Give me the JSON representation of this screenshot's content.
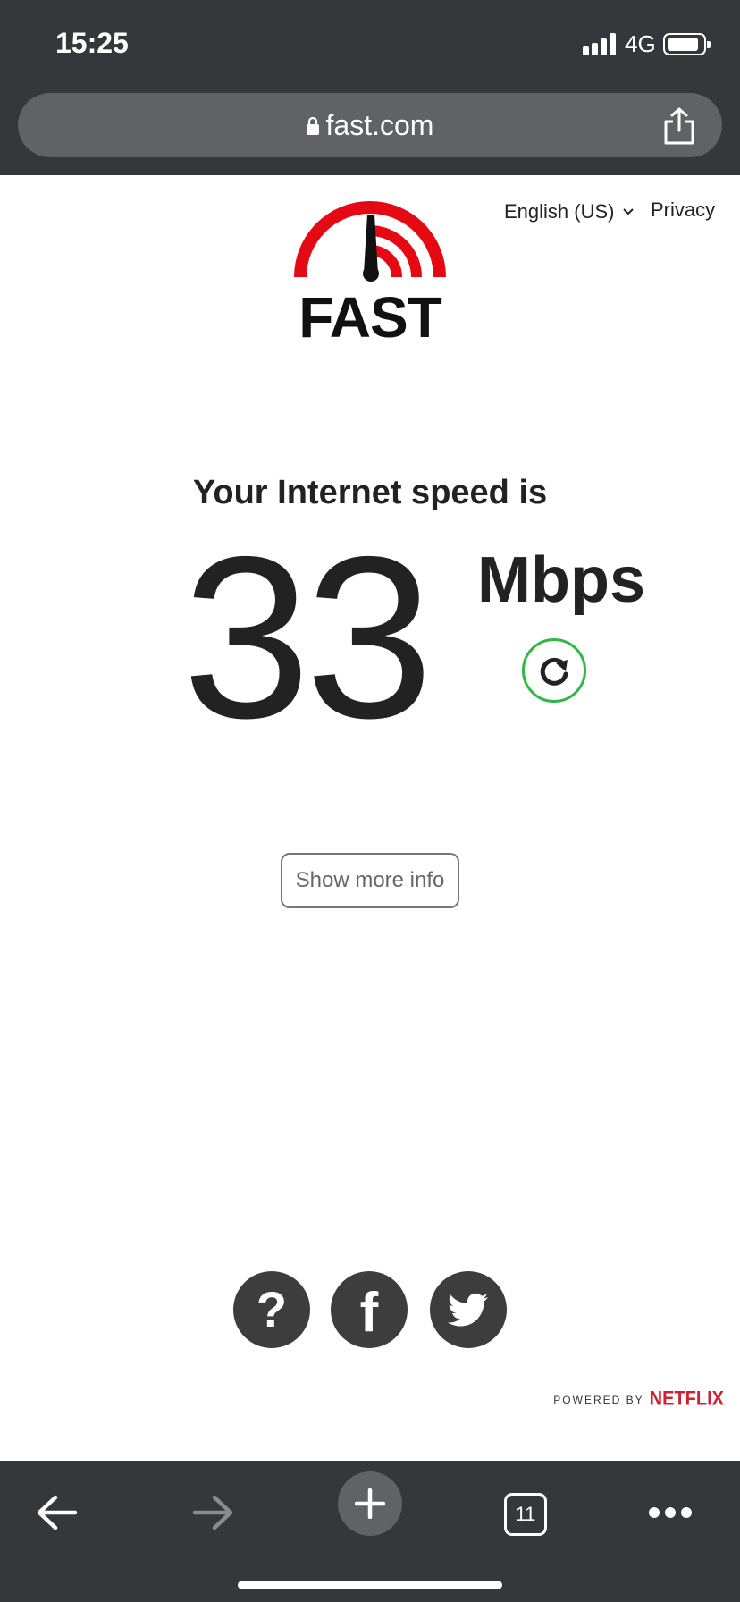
{
  "status_bar": {
    "time": "15:25",
    "network": "4G"
  },
  "browser": {
    "url": "fast.com",
    "tab_count": "11"
  },
  "header": {
    "language": "English (US)",
    "privacy_label": "Privacy",
    "logo_text": "FAST"
  },
  "speed_test": {
    "label": "Your Internet speed is",
    "value": "33",
    "units": "Mbps",
    "more_info_label": "Show more info"
  },
  "social": {
    "help_glyph": "?",
    "facebook_glyph": "f"
  },
  "footer": {
    "powered_by": "POWERED BY",
    "brand": "NETFLIX"
  },
  "colors": {
    "chrome_bg": "#35373a",
    "urlbar_bg": "#5f6366",
    "logo_red": "#e50914",
    "refresh_green": "#2db944",
    "netflix_red": "#d1202f",
    "social_bg": "#3d3d3d"
  },
  "icons": {
    "lock": "lock-icon",
    "share": "share-icon",
    "refresh": "refresh-icon",
    "back": "arrow-left-icon",
    "forward": "arrow-right-icon",
    "new_tab": "plus-icon",
    "menu": "more-dots-icon",
    "twitter": "twitter-bird-icon"
  }
}
